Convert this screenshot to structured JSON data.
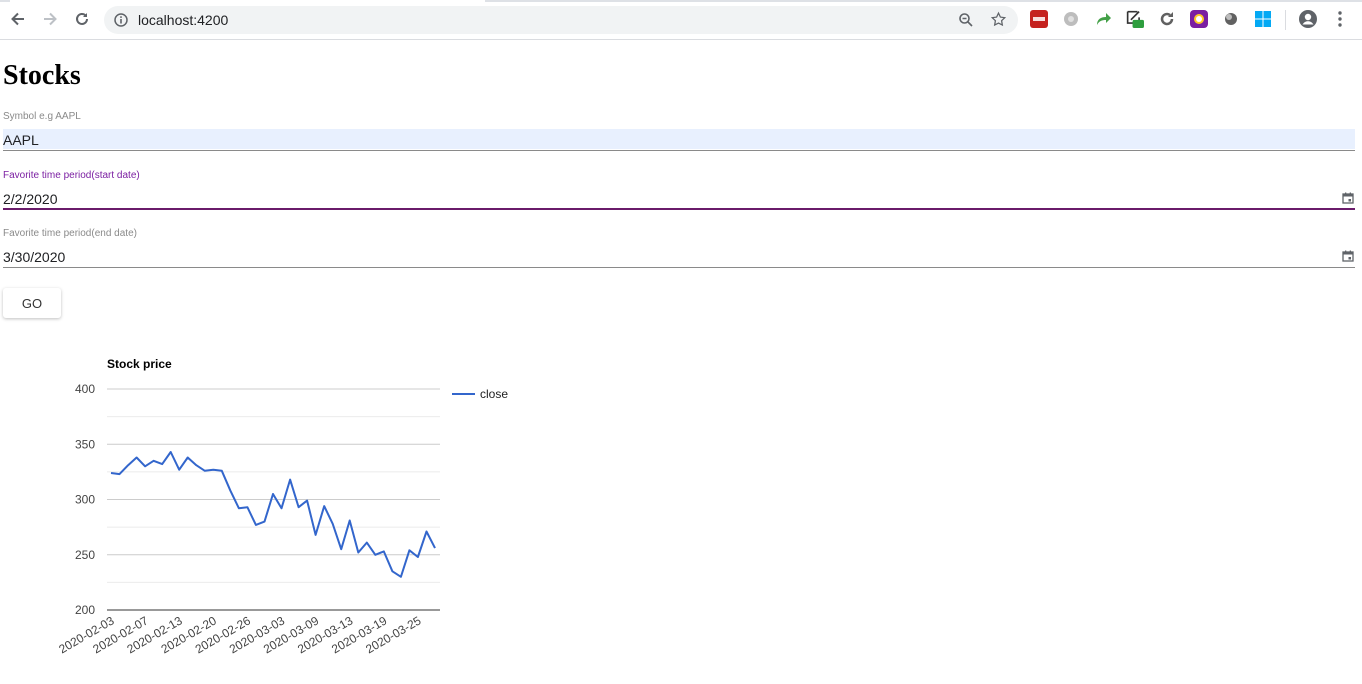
{
  "browser": {
    "url": "localhost:4200"
  },
  "page": {
    "title": "Stocks",
    "symbol_label": "Symbol e.g AAPL",
    "symbol_value": "AAPL",
    "start_label": "Favorite time period(start date)",
    "start_value": "2/2/2020",
    "end_label": "Favorite time period(end date)",
    "end_value": "3/30/2020",
    "go_label": "GO"
  },
  "colors": {
    "line": "#3366cc",
    "focus_label": "#7b1fa2",
    "autofill": "#e8f0fe"
  },
  "chart_data": {
    "type": "line",
    "title": "Stock price",
    "xlabel": "",
    "ylabel": "",
    "ylim": [
      200,
      400
    ],
    "yticks": [
      200,
      250,
      300,
      350,
      400
    ],
    "grid": true,
    "legend": "right",
    "xtick_labels": [
      "2020-02-03",
      "2020-02-07",
      "2020-02-13",
      "2020-02-20",
      "2020-02-26",
      "2020-03-03",
      "2020-03-09",
      "2020-03-13",
      "2020-03-19",
      "2020-03-25"
    ],
    "series": [
      {
        "name": "close",
        "x": [
          "2020-02-03",
          "2020-02-04",
          "2020-02-05",
          "2020-02-06",
          "2020-02-07",
          "2020-02-10",
          "2020-02-11",
          "2020-02-12",
          "2020-02-13",
          "2020-02-14",
          "2020-02-18",
          "2020-02-19",
          "2020-02-20",
          "2020-02-21",
          "2020-02-24",
          "2020-02-25",
          "2020-02-26",
          "2020-02-27",
          "2020-02-28",
          "2020-03-02",
          "2020-03-03",
          "2020-03-04",
          "2020-03-05",
          "2020-03-06",
          "2020-03-09",
          "2020-03-10",
          "2020-03-11",
          "2020-03-12",
          "2020-03-13",
          "2020-03-16",
          "2020-03-17",
          "2020-03-18",
          "2020-03-19",
          "2020-03-20",
          "2020-03-23",
          "2020-03-24",
          "2020-03-25",
          "2020-03-26",
          "2020-03-27"
        ],
        "values": [
          324,
          323,
          331,
          338,
          330,
          335,
          332,
          343,
          327,
          338,
          331,
          326,
          327,
          326,
          308,
          292,
          293,
          277,
          280,
          305,
          292,
          318,
          293,
          299,
          268,
          294,
          278,
          255,
          281,
          252,
          261,
          250,
          253,
          235,
          230,
          254,
          248,
          271,
          256
        ]
      }
    ]
  }
}
